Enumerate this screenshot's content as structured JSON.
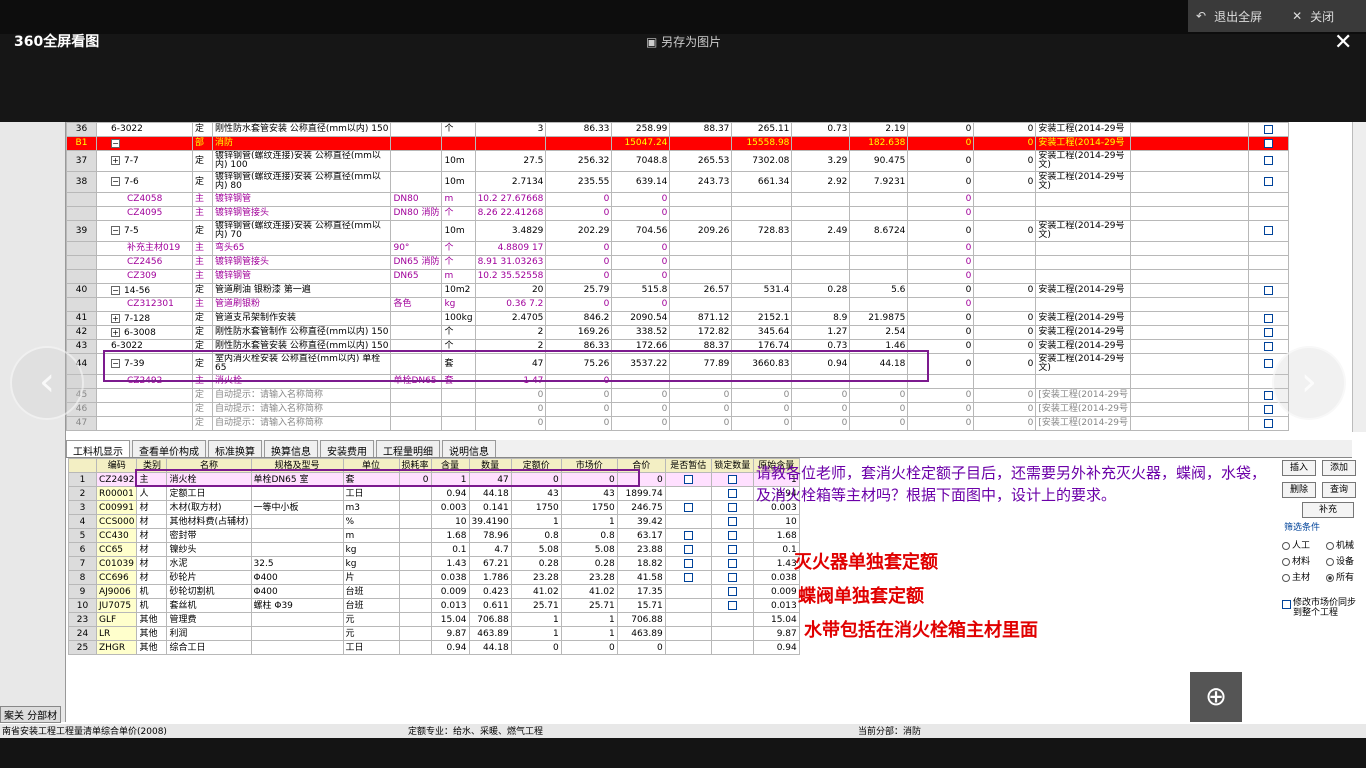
{
  "viewer": {
    "app_name": "360全屏看图",
    "save_label": "另存为图片",
    "exit_label": "退出全屏",
    "close_label": "关闭"
  },
  "upper_rows": [
    {
      "rn": "36",
      "code": "6-3022",
      "ex": "",
      "type": "定",
      "name": "刚性防水套管安装 公称直径(mm以内) 150",
      "spec": "",
      "unit": "个",
      "qty": "3",
      "v1": "86.33",
      "v2": "258.99",
      "v3": "88.37",
      "v4": "265.11",
      "v5": "0.73",
      "v6": "2.19",
      "v7": "0",
      "v8": "0",
      "std": "安装工程(2014-29号",
      "kind": "norm"
    },
    {
      "rn": "B1",
      "code": "",
      "ex": "−",
      "type": "部",
      "name": "消防",
      "spec": "",
      "unit": "",
      "qty": "",
      "v1": "",
      "v2": "15047.24",
      "v3": "",
      "v4": "15558.98",
      "v5": "",
      "v6": "182.638",
      "v7": "0",
      "v8": "0",
      "std": "安装工程(2014-29号",
      "kind": "red"
    },
    {
      "rn": "37",
      "code": "7-7",
      "ex": "+",
      "type": "定",
      "name": "镀锌钢管(螺纹连接)安装 公称直径(mm以内) 100",
      "spec": "",
      "unit": "10m",
      "qty": "27.5",
      "v1": "256.32",
      "v2": "7048.8",
      "v3": "265.53",
      "v4": "7302.08",
      "v5": "3.29",
      "v6": "90.475",
      "v7": "0",
      "v8": "0",
      "std": "安装工程(2014-29号文)",
      "kind": "tall"
    },
    {
      "rn": "38",
      "code": "7-6",
      "ex": "−",
      "type": "定",
      "name": "镀锌钢管(螺纹连接)安装 公称直径(mm以内) 80",
      "spec": "",
      "unit": "10m",
      "qty": "2.7134",
      "v1": "235.55",
      "v2": "639.14",
      "v3": "243.73",
      "v4": "661.34",
      "v5": "2.92",
      "v6": "7.9231",
      "v7": "0",
      "v8": "0",
      "std": "安装工程(2014-29号文)",
      "kind": "tall"
    },
    {
      "rn": "",
      "code": "CZ4058",
      "ex": "",
      "type": "主",
      "name": "镀锌钢管",
      "spec": "DN80",
      "unit": "m",
      "qty": "10.2 27.67668",
      "v1": "0",
      "v2": "0",
      "v3": "",
      "v4": "",
      "v5": "",
      "v6": "",
      "v7": "0",
      "v8": "",
      "std": "",
      "kind": "mat"
    },
    {
      "rn": "",
      "code": "CZ4095",
      "ex": "",
      "type": "主",
      "name": "镀锌钢管接头",
      "spec": "DN80 消防",
      "unit": "个",
      "qty": "8.26 22.41268",
      "v1": "0",
      "v2": "0",
      "v3": "",
      "v4": "",
      "v5": "",
      "v6": "",
      "v7": "0",
      "v8": "",
      "std": "",
      "kind": "mat"
    },
    {
      "rn": "39",
      "code": "7-5",
      "ex": "−",
      "type": "定",
      "name": "镀锌钢管(螺纹连接)安装 公称直径(mm以内) 70",
      "spec": "",
      "unit": "10m",
      "qty": "3.4829",
      "v1": "202.29",
      "v2": "704.56",
      "v3": "209.26",
      "v4": "728.83",
      "v5": "2.49",
      "v6": "8.6724",
      "v7": "0",
      "v8": "0",
      "std": "安装工程(2014-29号文)",
      "kind": "tall"
    },
    {
      "rn": "",
      "code": "补充主材019",
      "ex": "",
      "type": "主",
      "name": "弯头65",
      "spec": "90°",
      "unit": "个",
      "qty": "4.8809 17",
      "v1": "0",
      "v2": "0",
      "v3": "",
      "v4": "",
      "v5": "",
      "v6": "",
      "v7": "0",
      "v8": "",
      "std": "",
      "kind": "mat"
    },
    {
      "rn": "",
      "code": "CZ2456",
      "ex": "",
      "type": "主",
      "name": "镀锌钢管接头",
      "spec": "DN65 消防",
      "unit": "个",
      "qty": "8.91 31.03263",
      "v1": "0",
      "v2": "0",
      "v3": "",
      "v4": "",
      "v5": "",
      "v6": "",
      "v7": "0",
      "v8": "",
      "std": "",
      "kind": "mat"
    },
    {
      "rn": "",
      "code": "CZ309",
      "ex": "",
      "type": "主",
      "name": "镀锌钢管",
      "spec": "DN65",
      "unit": "m",
      "qty": "10.2 35.52558",
      "v1": "0",
      "v2": "0",
      "v3": "",
      "v4": "",
      "v5": "",
      "v6": "",
      "v7": "0",
      "v8": "",
      "std": "",
      "kind": "mat"
    },
    {
      "rn": "40",
      "code": "14-56",
      "ex": "−",
      "type": "定",
      "name": "管道刷油 银粉漆 第一遍",
      "spec": "",
      "unit": "10m2",
      "qty": "20",
      "v1": "25.79",
      "v2": "515.8",
      "v3": "26.57",
      "v4": "531.4",
      "v5": "0.28",
      "v6": "5.6",
      "v7": "0",
      "v8": "0",
      "std": "安装工程(2014-29号",
      "kind": "norm"
    },
    {
      "rn": "",
      "code": "CZ312301",
      "ex": "",
      "type": "主",
      "name": "管道刷银粉",
      "spec": "各色",
      "unit": "kg",
      "qty": "0.36 7.2",
      "v1": "0",
      "v2": "0",
      "v3": "",
      "v4": "",
      "v5": "",
      "v6": "",
      "v7": "0",
      "v8": "",
      "std": "",
      "kind": "mat"
    },
    {
      "rn": "41",
      "code": "7-128",
      "ex": "+",
      "type": "定",
      "name": "管道支吊架制作安装",
      "spec": "",
      "unit": "100kg",
      "qty": "2.4705",
      "v1": "846.2",
      "v2": "2090.54",
      "v3": "871.12",
      "v4": "2152.1",
      "v5": "8.9",
      "v6": "21.9875",
      "v7": "0",
      "v8": "0",
      "std": "安装工程(2014-29号",
      "kind": "norm"
    },
    {
      "rn": "42",
      "code": "6-3008",
      "ex": "+",
      "type": "定",
      "name": "刚性防水套管制作 公称直径(mm以内) 150",
      "spec": "",
      "unit": "个",
      "qty": "2",
      "v1": "169.26",
      "v2": "338.52",
      "v3": "172.82",
      "v4": "345.64",
      "v5": "1.27",
      "v6": "2.54",
      "v7": "0",
      "v8": "0",
      "std": "安装工程(2014-29号",
      "kind": "norm"
    },
    {
      "rn": "43",
      "code": "6-3022",
      "ex": "",
      "type": "定",
      "name": "刚性防水套管安装 公称直径(mm以内) 150",
      "spec": "",
      "unit": "个",
      "qty": "2",
      "v1": "86.33",
      "v2": "172.66",
      "v3": "88.37",
      "v4": "176.74",
      "v5": "0.73",
      "v6": "1.46",
      "v7": "0",
      "v8": "0",
      "std": "安装工程(2014-29号",
      "kind": "norm"
    },
    {
      "rn": "44",
      "code": "7-39",
      "ex": "−",
      "type": "定",
      "name": "室内消火栓安装 公称直径(mm以内) 单栓65",
      "spec": "",
      "unit": "套",
      "qty": "47",
      "v1": "75.26",
      "v2": "3537.22",
      "v3": "77.89",
      "v4": "3660.83",
      "v5": "0.94",
      "v6": "44.18",
      "v7": "0",
      "v8": "0",
      "std": "安装工程(2014-29号文)",
      "kind": "tall"
    },
    {
      "rn": "",
      "code": "CZ2492",
      "ex": "",
      "type": "主",
      "name": "消火栓",
      "spec": "单栓DN65",
      "unit": "套",
      "qty": "1 47",
      "v1": "0",
      "v2": "",
      "v3": "",
      "v4": "",
      "v5": "",
      "v6": "",
      "v7": "",
      "v8": "",
      "std": "",
      "kind": "mat"
    },
    {
      "rn": "45",
      "code": "",
      "ex": "",
      "type": "定",
      "name": "自动提示：请输入名称简称",
      "spec": "",
      "unit": "",
      "qty": "0",
      "v1": "0",
      "v2": "0",
      "v3": "0",
      "v4": "0",
      "v5": "0",
      "v6": "0",
      "v7": "0",
      "v8": "0",
      "std": "[安装工程(2014-29号",
      "kind": "hint"
    },
    {
      "rn": "46",
      "code": "",
      "ex": "",
      "type": "定",
      "name": "自动提示：请输入名称简称",
      "spec": "",
      "unit": "",
      "qty": "0",
      "v1": "0",
      "v2": "0",
      "v3": "0",
      "v4": "0",
      "v5": "0",
      "v6": "0",
      "v7": "0",
      "v8": "0",
      "std": "[安装工程(2014-29号",
      "kind": "hint"
    },
    {
      "rn": "47",
      "code": "",
      "ex": "",
      "type": "定",
      "name": "自动提示：请输入名称简称",
      "spec": "",
      "unit": "",
      "qty": "0",
      "v1": "0",
      "v2": "0",
      "v3": "0",
      "v4": "0",
      "v5": "0",
      "v6": "0",
      "v7": "0",
      "v8": "0",
      "std": "[安装工程(2014-29号",
      "kind": "hint"
    }
  ],
  "tabs": [
    "工料机显示",
    "查看单价构成",
    "标准换算",
    "换算信息",
    "安装费用",
    "工程量明细",
    "说明信息"
  ],
  "lower_headers": [
    "",
    "编码",
    "类别",
    "名称",
    "规格及型号",
    "单位",
    "损耗率",
    "含量",
    "数量",
    "定额价",
    "市场价",
    "合价",
    "是否暂估",
    "锁定数量",
    "原始含量"
  ],
  "lower_rows": [
    [
      "1",
      "CZ2492",
      "主",
      "消火栓",
      "单栓DN65 室",
      "套",
      "0",
      "1",
      "47",
      "0",
      "0",
      "0",
      "cb",
      "cb",
      "1"
    ],
    [
      "2",
      "R00001",
      "人",
      "定额工日",
      "",
      "工日",
      "",
      "0.94",
      "44.18",
      "43",
      "43",
      "1899.74",
      "",
      "cb",
      "0.94"
    ],
    [
      "3",
      "C00991",
      "材",
      "木材(取方材)",
      "一等中小板",
      "m3",
      "",
      "0.003",
      "0.141",
      "1750",
      "1750",
      "246.75",
      "cb",
      "cb",
      "0.003"
    ],
    [
      "4",
      "CCS000",
      "材",
      "其他材料费(占辅材)",
      "",
      "%",
      "",
      "10",
      "39.4190",
      "1",
      "1",
      "39.42",
      "",
      "cb",
      "10"
    ],
    [
      "5",
      "CC430",
      "材",
      "密封带",
      "",
      "m",
      "",
      "1.68",
      "78.96",
      "0.8",
      "0.8",
      "63.17",
      "cb",
      "cb",
      "1.68"
    ],
    [
      "6",
      "CC65",
      "材",
      "镍纱头",
      "",
      "kg",
      "",
      "0.1",
      "4.7",
      "5.08",
      "5.08",
      "23.88",
      "cb",
      "cb",
      "0.1"
    ],
    [
      "7",
      "C01039",
      "材",
      "水泥",
      "32.5",
      "kg",
      "",
      "1.43",
      "67.21",
      "0.28",
      "0.28",
      "18.82",
      "cb",
      "cb",
      "1.43"
    ],
    [
      "8",
      "CC696",
      "材",
      "砂轮片",
      "Φ400",
      "片",
      "",
      "0.038",
      "1.786",
      "23.28",
      "23.28",
      "41.58",
      "cb",
      "cb",
      "0.038"
    ],
    [
      "9",
      "AJ9006",
      "机",
      "砂轮切割机",
      "Φ400",
      "台班",
      "",
      "0.009",
      "0.423",
      "41.02",
      "41.02",
      "17.35",
      "",
      "cb",
      "0.009"
    ],
    [
      "10",
      "JU7075",
      "机",
      "套丝机",
      "螺柱 Φ39",
      "台班",
      "",
      "0.013",
      "0.611",
      "25.71",
      "25.71",
      "15.71",
      "",
      "cb",
      "0.013"
    ],
    [
      "23",
      "GLF",
      "其他",
      "管理费",
      "",
      "元",
      "",
      "15.04",
      "706.88",
      "1",
      "1",
      "706.88",
      "",
      "",
      "15.04"
    ],
    [
      "24",
      "LR",
      "其他",
      "利润",
      "",
      "元",
      "",
      "9.87",
      "463.89",
      "1",
      "1",
      "463.89",
      "",
      "",
      "9.87"
    ],
    [
      "25",
      "ZHGR",
      "其他",
      "综合工日",
      "",
      "工日",
      "",
      "0.94",
      "44.18",
      "0",
      "0",
      "0",
      "",
      "",
      "0.94"
    ]
  ],
  "question_text": "请教各位老师，套消火栓定额子目后，还需要另外补充灭火器，蝶阀，水袋，及消火栓箱等主材吗？根据下面图中，设计上的要求。",
  "notes": [
    "灭火器单独套定额",
    "蝶阀单独套定额",
    "水带包括在消火栓箱主材里面"
  ],
  "right_panel": {
    "insert": "插入",
    "add": "添加",
    "delete": "删除",
    "query": "查询",
    "supplement": "补充",
    "filter_title": "筛选条件",
    "radios": [
      "人工",
      "机械",
      "材料",
      "设备",
      "主材",
      "所有"
    ],
    "sync_label": "修改市场价同步到整个工程"
  },
  "side_tab": "案关 分部材",
  "status": {
    "left": "南省安装工程工程量清单综合单价(2008)",
    "mid": "定额专业：给水、采暖、燃气工程",
    "right": "当前分部：消防"
  }
}
